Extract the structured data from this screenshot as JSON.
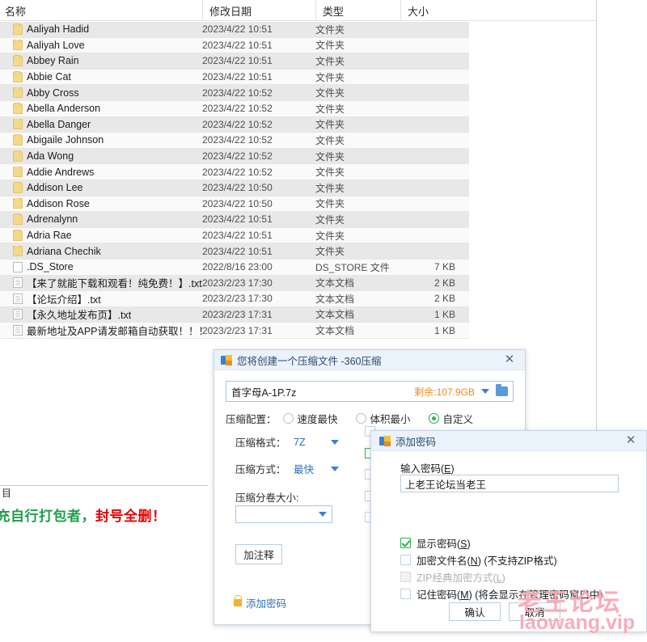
{
  "explorer": {
    "columns": [
      "名称",
      "修改日期",
      "类型",
      "大小"
    ],
    "rows": [
      {
        "name": "Aaliyah Hadid",
        "date": "2023/4/22 10:51",
        "type": "文件夹",
        "size": "",
        "icon": "folder-icon"
      },
      {
        "name": "Aaliyah Love",
        "date": "2023/4/22 10:51",
        "type": "文件夹",
        "size": "",
        "icon": "folder-icon"
      },
      {
        "name": "Abbey Rain",
        "date": "2023/4/22 10:51",
        "type": "文件夹",
        "size": "",
        "icon": "folder-icon"
      },
      {
        "name": "Abbie Cat",
        "date": "2023/4/22 10:51",
        "type": "文件夹",
        "size": "",
        "icon": "folder-icon"
      },
      {
        "name": "Abby Cross",
        "date": "2023/4/22 10:52",
        "type": "文件夹",
        "size": "",
        "icon": "folder-icon"
      },
      {
        "name": "Abella Anderson",
        "date": "2023/4/22 10:52",
        "type": "文件夹",
        "size": "",
        "icon": "folder-icon"
      },
      {
        "name": "Abella Danger",
        "date": "2023/4/22 10:52",
        "type": "文件夹",
        "size": "",
        "icon": "folder-icon"
      },
      {
        "name": "Abigaile Johnson",
        "date": "2023/4/22 10:52",
        "type": "文件夹",
        "size": "",
        "icon": "folder-icon"
      },
      {
        "name": "Ada Wong",
        "date": "2023/4/22 10:52",
        "type": "文件夹",
        "size": "",
        "icon": "folder-icon"
      },
      {
        "name": "Addie Andrews",
        "date": "2023/4/22 10:52",
        "type": "文件夹",
        "size": "",
        "icon": "folder-icon"
      },
      {
        "name": "Addison Lee",
        "date": "2023/4/22 10:50",
        "type": "文件夹",
        "size": "",
        "icon": "folder-icon"
      },
      {
        "name": "Addison Rose",
        "date": "2023/4/22 10:50",
        "type": "文件夹",
        "size": "",
        "icon": "folder-icon"
      },
      {
        "name": "Adrenalynn",
        "date": "2023/4/22 10:51",
        "type": "文件夹",
        "size": "",
        "icon": "folder-icon"
      },
      {
        "name": "Adria Rae",
        "date": "2023/4/22 10:51",
        "type": "文件夹",
        "size": "",
        "icon": "folder-icon"
      },
      {
        "name": "Adriana Chechik",
        "date": "2023/4/22 10:51",
        "type": "文件夹",
        "size": "",
        "icon": "folder-icon"
      },
      {
        "name": ".DS_Store",
        "date": "2022/8/16 23:00",
        "type": "DS_STORE 文件",
        "size": "7 KB",
        "icon": "file-blank-icon"
      },
      {
        "name": "【来了就能下载和观看！纯免费！】.txt",
        "date": "2023/2/23 17:30",
        "type": "文本文档",
        "size": "2 KB",
        "icon": "text-file-icon"
      },
      {
        "name": "【论坛介绍】.txt",
        "date": "2023/2/23 17:30",
        "type": "文本文档",
        "size": "2 KB",
        "icon": "text-file-icon"
      },
      {
        "name": "【永久地址发布页】.txt",
        "date": "2023/2/23 17:31",
        "type": "文本文档",
        "size": "1 KB",
        "icon": "text-file-icon"
      },
      {
        "name": "最新地址及APP请发邮箱自动获取！！！....",
        "date": "2023/2/23 17:31",
        "type": "文本文档",
        "size": "1 KB",
        "icon": "text-file-icon"
      }
    ],
    "footer_fragment": "目",
    "banner_green": "冒充自行打包者，",
    "banner_red": "封号全删！"
  },
  "compress_dialog": {
    "title": "您将创建一个压缩文件 -360压缩",
    "close_label": "✕",
    "filename": "首字母A-1P.7z",
    "remaining": "剩余:107.9GB",
    "config_label": "压缩配置：",
    "config_options": [
      {
        "label": "速度最快",
        "selected": false
      },
      {
        "label": "体积最小",
        "selected": false
      },
      {
        "label": "自定义",
        "selected": true
      }
    ],
    "format_label": "压缩格式：",
    "format_value": "7Z",
    "method_label": "压缩方式：",
    "method_value": "最快",
    "split_label": "压缩分卷大小:",
    "split_value": "",
    "comment_button": "加注释",
    "add_password_link": "添加密码"
  },
  "password_dialog": {
    "title": "添加密码",
    "close_label": "✕",
    "input_label_main": "输入密码(",
    "input_label_key": "E",
    "input_label_end": ")",
    "password_value": "上老王论坛当老王",
    "checkboxes": [
      {
        "label_main": "显示密码(",
        "key": "S",
        "label_end": ")",
        "suffix": "",
        "checked": true,
        "disabled": false
      },
      {
        "label_main": "加密文件名(",
        "key": "N",
        "label_end": ")",
        "suffix": " (不支持ZIP格式)",
        "checked": false,
        "disabled": false
      },
      {
        "label_main": "ZIP经典加密方式(",
        "key": "L",
        "label_end": ")",
        "suffix": "",
        "checked": false,
        "disabled": true
      },
      {
        "label_main": "记住密码(",
        "key": "M",
        "label_end": ")",
        "suffix": " (将会显示在管理密码窗口中)",
        "checked": false,
        "disabled": false
      }
    ],
    "confirm_button": "确认",
    "cancel_button": "取消"
  },
  "watermark": {
    "chinese": "老王论坛",
    "english": "laowang.vip",
    "color": "#f9a8b8"
  },
  "colors": {
    "accent_blue": "#3b7fd4",
    "title_bg": "#eaf2fb",
    "radio_green": "#2cb34a",
    "remaining_orange": "#ef8b18",
    "folder_yellow": "#f6d88a",
    "banner_green": "#1e9e4a",
    "banner_red": "#e60000"
  }
}
